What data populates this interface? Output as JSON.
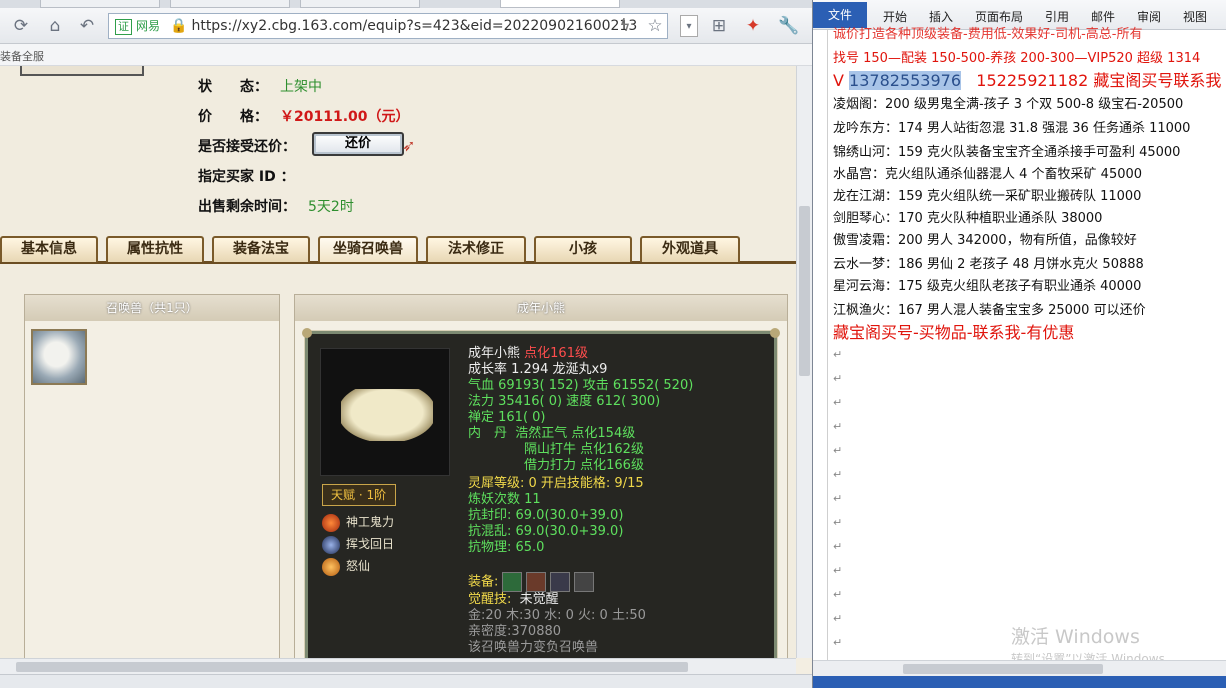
{
  "browser": {
    "url_cert_label": "证",
    "url_cert_name": "网易",
    "url": "https://xy2.cbg.163.com/equip?s=423&eid=202209021600213",
    "bookmark": "装备全服"
  },
  "listing": {
    "status_label": "状　　态：",
    "status_value": "上架中",
    "price_label": "价　　格：",
    "price_value": "￥20111.00（元）",
    "counter_label": "是否接受还价：",
    "counter_button": "还价",
    "buyer_label": "指定买家 ID ：",
    "remaining_label": "出售剩余时间：",
    "remaining_value": "5天2时"
  },
  "tabs": [
    "基本信息",
    "属性抗性",
    "装备法宝",
    "坐骑召唤兽",
    "法术修正",
    "小孩",
    "外观道具"
  ],
  "summon_panel": {
    "title": "召唤兽（共1只）"
  },
  "detail_panel": {
    "title": "成年小熊",
    "name": "成年小熊",
    "level": "点化161级",
    "growth": "成长率 1.294 龙涎丸x9",
    "hp_line": "气血 69193( 152) 攻击 61552( 520)",
    "mp_line": "法力 35416( 0) 速度 612( 300)",
    "zen_line": "禅定 161( 0)",
    "inner_label": "内　丹",
    "inner1": "浩然正气 点化154级",
    "inner2": "隔山打牛 点化162级",
    "inner3": "借力打力 点化166级",
    "spirit": "灵犀等级: 0 开启技能格: 9/15",
    "refine": "炼妖次数 11",
    "resist_seal": "抗封印: 69.0(30.0+39.0)",
    "resist_chaos": "抗混乱: 69.0(30.0+39.0)",
    "resist_phys": "抗物理: 65.0",
    "equip_label": "装备:",
    "awaken_label": "觉醒技:",
    "awaken_value": "未觉醒",
    "elements": "金:20 木:30 水: 0 火: 0 土:50",
    "intimacy": "亲密度:370880",
    "footer": "该召唤兽力变负召唤兽",
    "talent": "天赋 · 1阶",
    "skills": [
      "神工鬼力",
      "挥戈回日",
      "怒仙"
    ]
  },
  "word": {
    "file_tab": "文件",
    "ribbon_tabs": [
      "开始",
      "插入",
      "页面布局",
      "引用",
      "邮件",
      "审阅",
      "视图"
    ],
    "lines": [
      "诚价打造各种顶级装备-费用低-效果好-司机-高总-所有",
      "找号 150—配装 150-500-养孩 200-300—VIP520 超级 1314",
      "13782553976",
      "15225921182 藏宝阁买号联系我",
      "凌烟阁：200 级男鬼全满-孩子 3 个双 500-8 级宝石-20500",
      "龙吟东方：174 男人站街忽混 31.8 强混 36 任务通杀 11000",
      "锦绣山河：159 克火队装备宝宝齐全通杀接手可盈利 45000",
      "水晶宫：克火组队通杀仙器混人 4 个畜牧采矿 45000",
      "龙在江湖：159 克火组队统一采矿职业搬砖队 11000",
      "剑胆琴心：170 克火队种植职业通杀队 38000",
      "傲雪凌霜：200 男人 342000，物有所值，品像较好",
      "云水一梦：186 男仙 2 老孩子 48 月饼水克火 50888",
      "星河云海：175 级克火组队老孩子有职业通杀 40000",
      "江枫渔火：167 男人混人装备宝宝多 25000 可以还价",
      "藏宝阁买号-买物品-联系我-有优惠"
    ],
    "v_prefix": "V",
    "para_mark": "↵",
    "watermark": "激活 Windows",
    "watermark_sub": "转到“设置”以激活 Windows。"
  }
}
